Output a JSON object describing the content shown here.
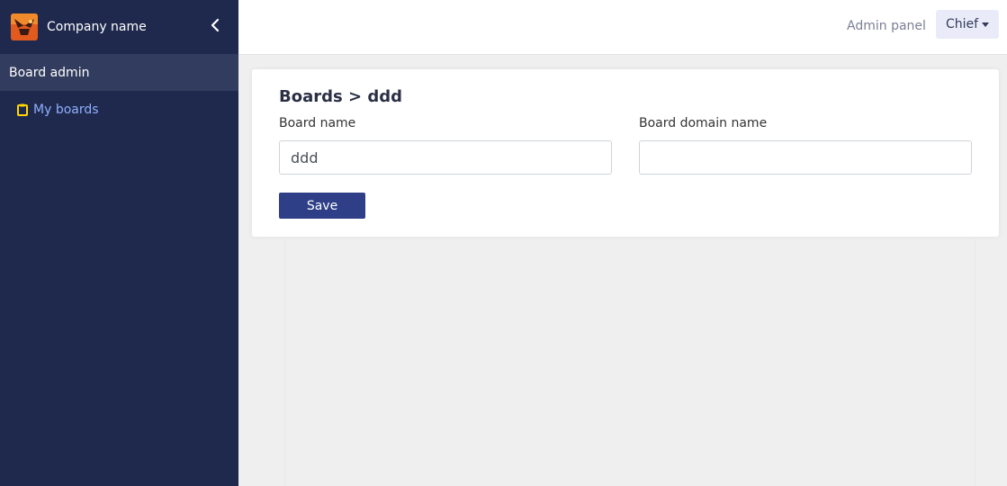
{
  "sidebar": {
    "company_name": "Company name",
    "section_title": "Board admin",
    "items": [
      {
        "label": "My boards",
        "icon": "clipboard-icon"
      }
    ]
  },
  "topbar": {
    "admin_link": "Admin panel",
    "user_menu": "Chief"
  },
  "main": {
    "heading": "Boards > ddd",
    "board_name_label": "Board name",
    "board_name_value": "ddd",
    "board_domain_label": "Board domain name",
    "board_domain_value": "",
    "save_label": "Save"
  },
  "colors": {
    "sidebar_bg": "#1f294d",
    "sidebar_section_bg": "#323c5e",
    "link": "#8fb0ff",
    "primary_button": "#2e3f87",
    "icon_accent": "#ffd600"
  }
}
